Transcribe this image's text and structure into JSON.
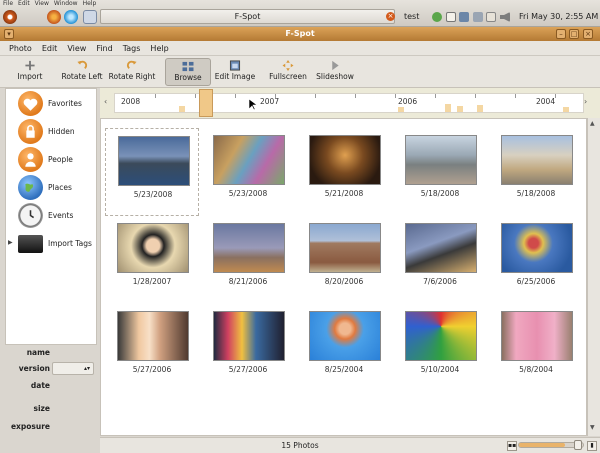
{
  "system": {
    "menus": [
      "File",
      "Edit",
      "View",
      "Window",
      "Help"
    ],
    "task_title": "F-Spot",
    "user": "test",
    "clock": "Fri May 30,  2:55 AM"
  },
  "window": {
    "title": "F-Spot"
  },
  "menubar": [
    "Photo",
    "Edit",
    "View",
    "Find",
    "Tags",
    "Help"
  ],
  "toolbar": {
    "import": "Import",
    "rotate_left": "Rotate Left",
    "rotate_right": "Rotate Right",
    "browse": "Browse",
    "edit_image": "Edit Image",
    "fullscreen": "Fullscreen",
    "slideshow": "Slideshow",
    "active": "browse"
  },
  "timeline": {
    "years": [
      "2008",
      "2007",
      "2006",
      "2004"
    ]
  },
  "sidebar": {
    "items": [
      {
        "label": "Favorites",
        "icon": "heart-icon"
      },
      {
        "label": "Hidden",
        "icon": "lock-icon"
      },
      {
        "label": "People",
        "icon": "person-icon"
      },
      {
        "label": "Places",
        "icon": "globe-icon"
      },
      {
        "label": "Events",
        "icon": "clock-icon"
      },
      {
        "label": "Import Tags",
        "icon": "image-icon"
      }
    ]
  },
  "info": {
    "name": "name",
    "version": "version",
    "date": "date",
    "size": "size",
    "exposure": "exposure"
  },
  "photos": [
    {
      "date": "5/23/2008"
    },
    {
      "date": "5/23/2008"
    },
    {
      "date": "5/21/2008"
    },
    {
      "date": "5/18/2008"
    },
    {
      "date": "5/18/2008"
    },
    {
      "date": "1/28/2007"
    },
    {
      "date": "8/21/2006"
    },
    {
      "date": "8/20/2006"
    },
    {
      "date": "7/6/2006"
    },
    {
      "date": "6/25/2006"
    },
    {
      "date": "5/27/2006"
    },
    {
      "date": "5/27/2006"
    },
    {
      "date": "8/25/2004"
    },
    {
      "date": "5/10/2004"
    },
    {
      "date": "5/8/2004"
    }
  ],
  "status": {
    "count": "15 Photos"
  },
  "colors": {
    "title_bar": "#c88a40",
    "selection": "#f0c888"
  }
}
